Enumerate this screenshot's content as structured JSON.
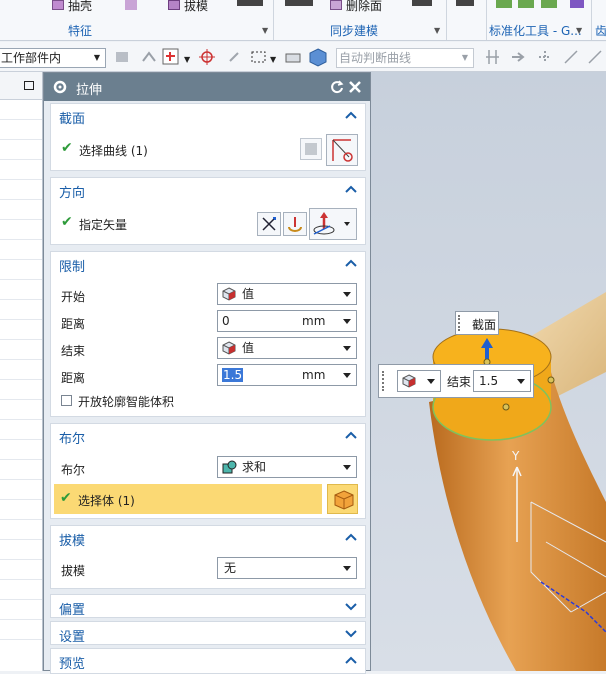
{
  "ribbon": {
    "buttons": [
      "抽壳",
      "拔模",
      "删除面"
    ],
    "groups": [
      "特征",
      "同步建模",
      "标准化工具 - G..."
    ]
  },
  "toolbar2": {
    "scope_value": "工作部件内",
    "curve_rule_placeholder": "自动判断曲线"
  },
  "dialog": {
    "title": "拉伸",
    "section_profile": {
      "title": "截面",
      "select_label": "选择曲线 (1)"
    },
    "section_direction": {
      "title": "方向",
      "vector_label": "指定矢量"
    },
    "section_limits": {
      "title": "限制",
      "start_label": "开始",
      "start_value": "值",
      "distance1_label": "距离",
      "distance1_value": "0",
      "distance1_unit": "mm",
      "end_label": "结束",
      "end_value": "值",
      "distance2_label": "距离",
      "distance2_value": "1.5",
      "distance2_unit": "mm",
      "open_profile_label": "开放轮廓智能体积"
    },
    "section_boolean": {
      "title": "布尔",
      "boolean_label": "布尔",
      "boolean_value": "求和",
      "select_body_label": "选择体 (1)"
    },
    "section_draft": {
      "title": "拔模",
      "draft_label": "拔模",
      "draft_value": "无"
    },
    "section_offset": {
      "title": "偏置"
    },
    "section_settings": {
      "title": "设置"
    },
    "section_preview": {
      "title": "预览"
    }
  },
  "viewport": {
    "section_tag": "截面",
    "end_label": "结束",
    "end_value": "1.5",
    "axis_y": "Y"
  },
  "colors": {
    "accent_blue": "#1a5ea8",
    "check_green": "#2e9b3a",
    "highlight_row": "#fbd974",
    "tube_orange": "#d98a2e"
  }
}
